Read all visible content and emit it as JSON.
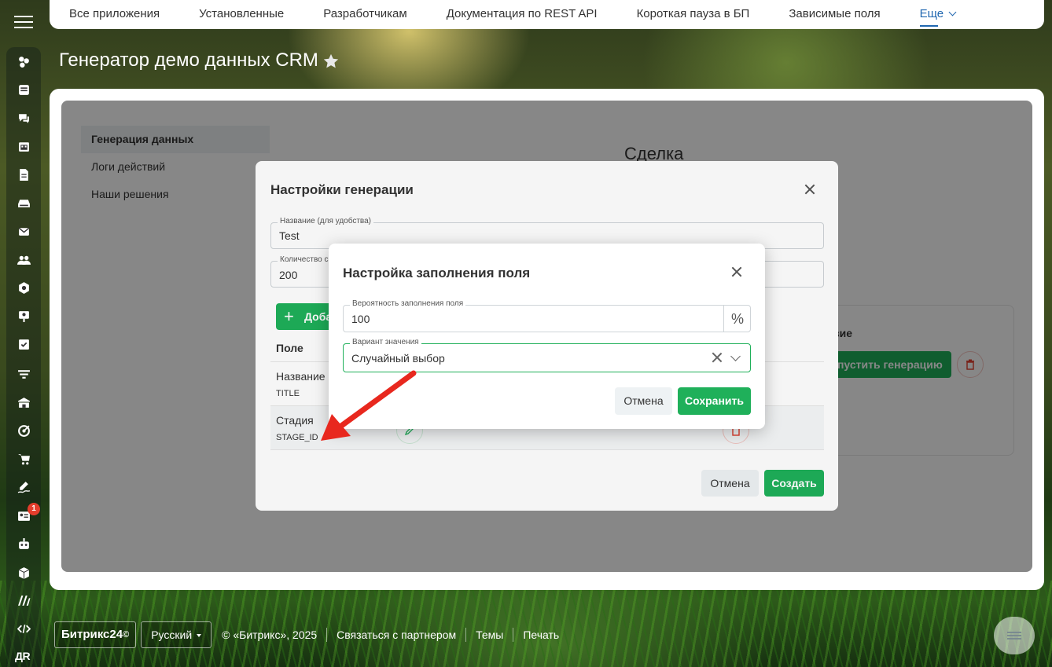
{
  "topnav": {
    "tabs": [
      {
        "label": "Все приложения"
      },
      {
        "label": "Установленные"
      },
      {
        "label": "Разработчикам"
      },
      {
        "label": "Документация по REST API"
      },
      {
        "label": "Короткая пауза в БП"
      },
      {
        "label": "Зависимые поля"
      }
    ],
    "more_label": "Еще"
  },
  "page": {
    "title": "Генератор демо данных CRM"
  },
  "sidebar": {
    "badge": "1",
    "user_initials": "ДR",
    "icons": [
      "sites-icon",
      "feed-icon",
      "chat-icon",
      "calendar-icon",
      "docs-icon",
      "drive-icon",
      "mail-icon",
      "groups-icon",
      "crm-icon",
      "presentation-icon",
      "tasks-icon",
      "filter-icon",
      "company-icon",
      "target-icon",
      "cart-icon",
      "sign-icon",
      "contact-card-icon",
      "robot-icon",
      "box-icon",
      "market-icon",
      "dev-icon"
    ]
  },
  "app": {
    "menu": [
      {
        "label": "Генерация данных",
        "active": true
      },
      {
        "label": "Логи действий",
        "active": false
      },
      {
        "label": "Наши решения",
        "active": false
      }
    ],
    "entity_heading": "Сделка",
    "right_panel": {
      "header": "вие",
      "run_label": "апустить генерацию"
    }
  },
  "modal_generation": {
    "title": "Настройки генерации",
    "name_label": "Название (для удобства)",
    "name_value": "Test",
    "count_label": "Количество с",
    "count_value": "200",
    "add_label": "Доба",
    "table_header": "Поле",
    "rows": [
      {
        "name": "Название",
        "code": "TITLE"
      },
      {
        "name": "Стадия",
        "code": "STAGE_ID"
      }
    ],
    "cancel_label": "Отмена",
    "create_label": "Создать"
  },
  "modal_field": {
    "title": "Настройка заполнения поля",
    "probability_label": "Вероятность заполнения поля",
    "probability_value": "100",
    "percent_sign": "%",
    "variant_label": "Вариант значения",
    "variant_value": "Случайный выбор",
    "cancel_label": "Отмена",
    "save_label": "Сохранить"
  },
  "footer": {
    "logo": "Битрикс24",
    "logo_mark": "©",
    "language": "Русский",
    "copyright": "© «Битрикс», 2025",
    "links": [
      "Связаться с партнером",
      "Темы",
      "Печать"
    ]
  },
  "colors": {
    "accent_green": "#1fb05a",
    "nav_active": "#2067b0",
    "danger": "#e43d2c",
    "annotation_arrow": "#e8281e"
  }
}
